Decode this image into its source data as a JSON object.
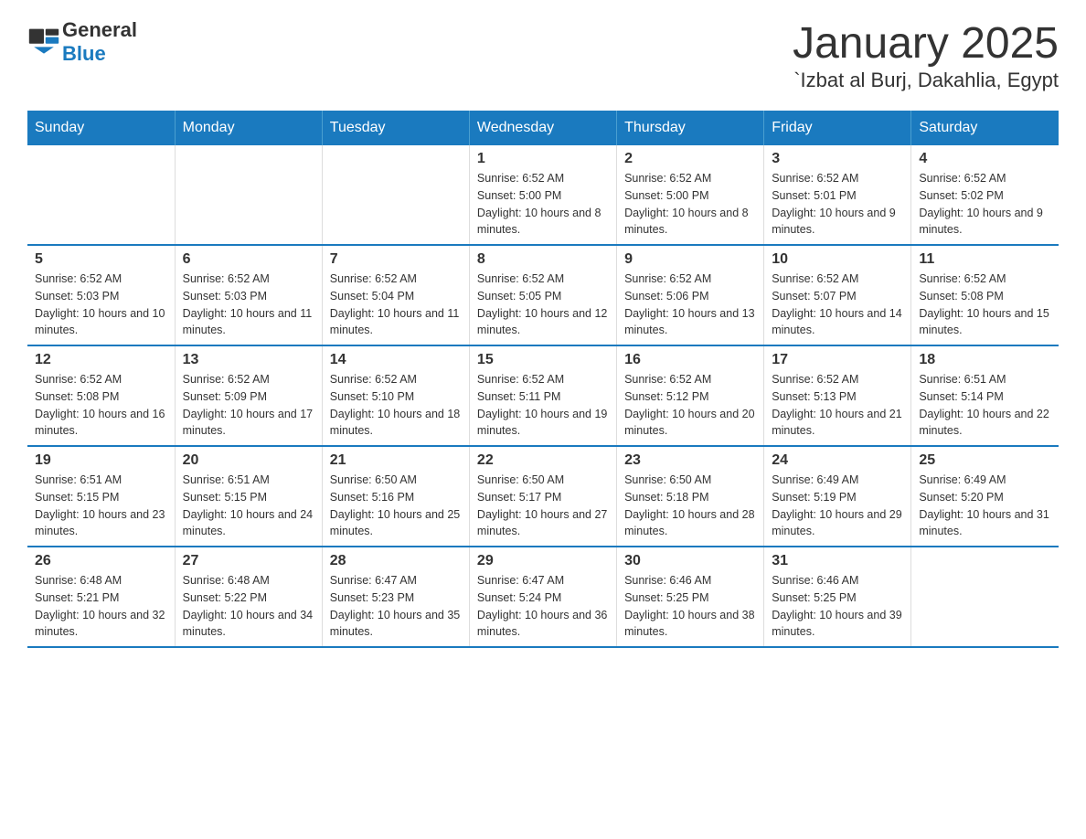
{
  "logo": {
    "text_general": "General",
    "text_blue": "Blue"
  },
  "title": "January 2025",
  "subtitle": "`Izbat al Burj, Dakahlia, Egypt",
  "days_of_week": [
    "Sunday",
    "Monday",
    "Tuesday",
    "Wednesday",
    "Thursday",
    "Friday",
    "Saturday"
  ],
  "weeks": [
    [
      {
        "day": "",
        "info": ""
      },
      {
        "day": "",
        "info": ""
      },
      {
        "day": "",
        "info": ""
      },
      {
        "day": "1",
        "info": "Sunrise: 6:52 AM\nSunset: 5:00 PM\nDaylight: 10 hours and 8 minutes."
      },
      {
        "day": "2",
        "info": "Sunrise: 6:52 AM\nSunset: 5:00 PM\nDaylight: 10 hours and 8 minutes."
      },
      {
        "day": "3",
        "info": "Sunrise: 6:52 AM\nSunset: 5:01 PM\nDaylight: 10 hours and 9 minutes."
      },
      {
        "day": "4",
        "info": "Sunrise: 6:52 AM\nSunset: 5:02 PM\nDaylight: 10 hours and 9 minutes."
      }
    ],
    [
      {
        "day": "5",
        "info": "Sunrise: 6:52 AM\nSunset: 5:03 PM\nDaylight: 10 hours and 10 minutes."
      },
      {
        "day": "6",
        "info": "Sunrise: 6:52 AM\nSunset: 5:03 PM\nDaylight: 10 hours and 11 minutes."
      },
      {
        "day": "7",
        "info": "Sunrise: 6:52 AM\nSunset: 5:04 PM\nDaylight: 10 hours and 11 minutes."
      },
      {
        "day": "8",
        "info": "Sunrise: 6:52 AM\nSunset: 5:05 PM\nDaylight: 10 hours and 12 minutes."
      },
      {
        "day": "9",
        "info": "Sunrise: 6:52 AM\nSunset: 5:06 PM\nDaylight: 10 hours and 13 minutes."
      },
      {
        "day": "10",
        "info": "Sunrise: 6:52 AM\nSunset: 5:07 PM\nDaylight: 10 hours and 14 minutes."
      },
      {
        "day": "11",
        "info": "Sunrise: 6:52 AM\nSunset: 5:08 PM\nDaylight: 10 hours and 15 minutes."
      }
    ],
    [
      {
        "day": "12",
        "info": "Sunrise: 6:52 AM\nSunset: 5:08 PM\nDaylight: 10 hours and 16 minutes."
      },
      {
        "day": "13",
        "info": "Sunrise: 6:52 AM\nSunset: 5:09 PM\nDaylight: 10 hours and 17 minutes."
      },
      {
        "day": "14",
        "info": "Sunrise: 6:52 AM\nSunset: 5:10 PM\nDaylight: 10 hours and 18 minutes."
      },
      {
        "day": "15",
        "info": "Sunrise: 6:52 AM\nSunset: 5:11 PM\nDaylight: 10 hours and 19 minutes."
      },
      {
        "day": "16",
        "info": "Sunrise: 6:52 AM\nSunset: 5:12 PM\nDaylight: 10 hours and 20 minutes."
      },
      {
        "day": "17",
        "info": "Sunrise: 6:52 AM\nSunset: 5:13 PM\nDaylight: 10 hours and 21 minutes."
      },
      {
        "day": "18",
        "info": "Sunrise: 6:51 AM\nSunset: 5:14 PM\nDaylight: 10 hours and 22 minutes."
      }
    ],
    [
      {
        "day": "19",
        "info": "Sunrise: 6:51 AM\nSunset: 5:15 PM\nDaylight: 10 hours and 23 minutes."
      },
      {
        "day": "20",
        "info": "Sunrise: 6:51 AM\nSunset: 5:15 PM\nDaylight: 10 hours and 24 minutes."
      },
      {
        "day": "21",
        "info": "Sunrise: 6:50 AM\nSunset: 5:16 PM\nDaylight: 10 hours and 25 minutes."
      },
      {
        "day": "22",
        "info": "Sunrise: 6:50 AM\nSunset: 5:17 PM\nDaylight: 10 hours and 27 minutes."
      },
      {
        "day": "23",
        "info": "Sunrise: 6:50 AM\nSunset: 5:18 PM\nDaylight: 10 hours and 28 minutes."
      },
      {
        "day": "24",
        "info": "Sunrise: 6:49 AM\nSunset: 5:19 PM\nDaylight: 10 hours and 29 minutes."
      },
      {
        "day": "25",
        "info": "Sunrise: 6:49 AM\nSunset: 5:20 PM\nDaylight: 10 hours and 31 minutes."
      }
    ],
    [
      {
        "day": "26",
        "info": "Sunrise: 6:48 AM\nSunset: 5:21 PM\nDaylight: 10 hours and 32 minutes."
      },
      {
        "day": "27",
        "info": "Sunrise: 6:48 AM\nSunset: 5:22 PM\nDaylight: 10 hours and 34 minutes."
      },
      {
        "day": "28",
        "info": "Sunrise: 6:47 AM\nSunset: 5:23 PM\nDaylight: 10 hours and 35 minutes."
      },
      {
        "day": "29",
        "info": "Sunrise: 6:47 AM\nSunset: 5:24 PM\nDaylight: 10 hours and 36 minutes."
      },
      {
        "day": "30",
        "info": "Sunrise: 6:46 AM\nSunset: 5:25 PM\nDaylight: 10 hours and 38 minutes."
      },
      {
        "day": "31",
        "info": "Sunrise: 6:46 AM\nSunset: 5:25 PM\nDaylight: 10 hours and 39 minutes."
      },
      {
        "day": "",
        "info": ""
      }
    ]
  ]
}
